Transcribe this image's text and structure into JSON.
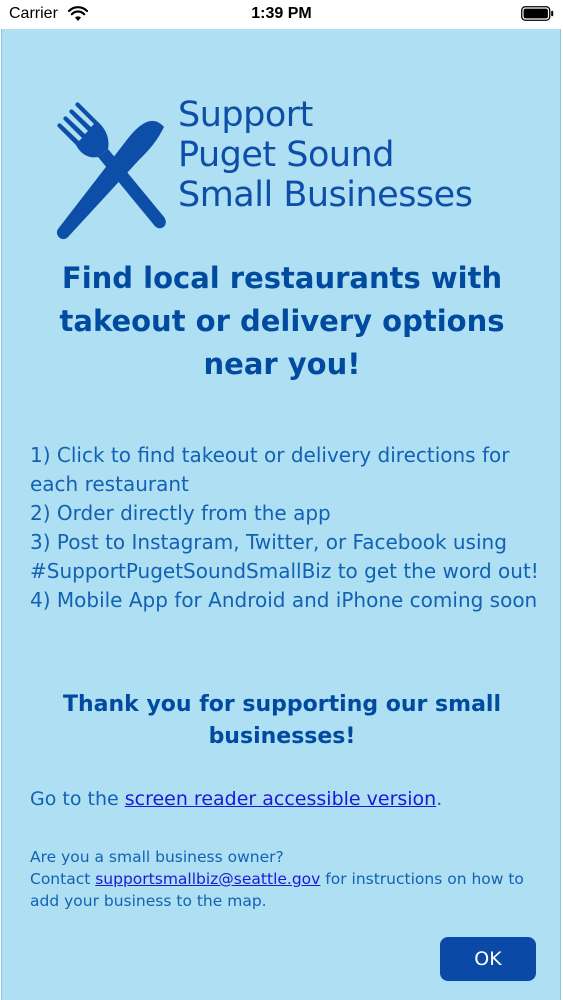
{
  "status_bar": {
    "carrier": "Carrier",
    "time": "1:39 PM"
  },
  "logo": {
    "icon": "fork-knife-icon",
    "line1": "Support",
    "line2": "Puget Sound",
    "line3": "Small Businesses"
  },
  "headline": {
    "line1": "Find local restaurants with",
    "line2": "takeout or delivery options",
    "line3": "near you!"
  },
  "steps": [
    "1) Click to find takeout or delivery directions for each restaurant",
    "2) Order directly from the app",
    "3) Post to Instagram, Twitter, or Facebook using #SupportPugetSoundSmallBiz to get the word out!",
    "4) Mobile App for Android and iPhone coming soon"
  ],
  "thanks": "Thank you for supporting our small businesses!",
  "reader": {
    "prefix": "Go to the ",
    "link": "screen reader accessible version",
    "suffix": "."
  },
  "owner": {
    "line1": "Are you a small business owner?",
    "prefix": "Contact ",
    "email": "supportsmallbiz@seattle.gov",
    "suffix": " for instructions on how to add your business to the map."
  },
  "ok_label": "OK",
  "colors": {
    "background": "#afdff3",
    "primary": "#004aa0",
    "button": "#0a4aa6",
    "link": "#1a1ad6"
  }
}
